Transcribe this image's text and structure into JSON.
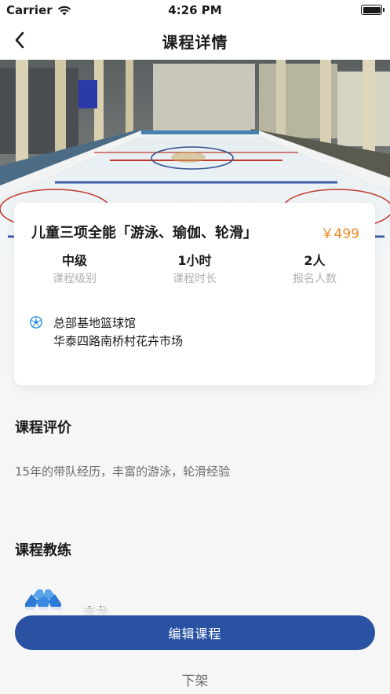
{
  "status_bar": {
    "carrier": "Carrier",
    "time": "4:26 PM",
    "icons": [
      "wifi-icon",
      "battery-icon"
    ]
  },
  "nav": {
    "title": "课程详情",
    "back_icon": "chevron-left-icon"
  },
  "hero": {
    "image": "ice-rink-photo"
  },
  "course": {
    "title": "儿童三项全能「游泳、瑜伽、轮滑」",
    "price": "￥499",
    "stats": [
      {
        "value": "中级",
        "label": "课程级别"
      },
      {
        "value": "1小时",
        "label": "课程时长"
      },
      {
        "value": "2人",
        "label": "报名人数"
      }
    ],
    "location": {
      "icon": "soccer-ball-icon",
      "venue": "总部基地篮球馆",
      "address": "华泰四路南桥村花卉市场"
    }
  },
  "review": {
    "title": "课程评价",
    "text": "15年的带队经历，丰富的游泳，轮滑经验"
  },
  "coach": {
    "title": "课程教练",
    "name": "李龙"
  },
  "actions": {
    "edit_label": "编辑课程",
    "offline_label": "下架"
  },
  "colors": {
    "primary": "#2952a3",
    "price": "#f08a24",
    "muted": "#b0b0b0",
    "background": "#f6f6f6"
  }
}
